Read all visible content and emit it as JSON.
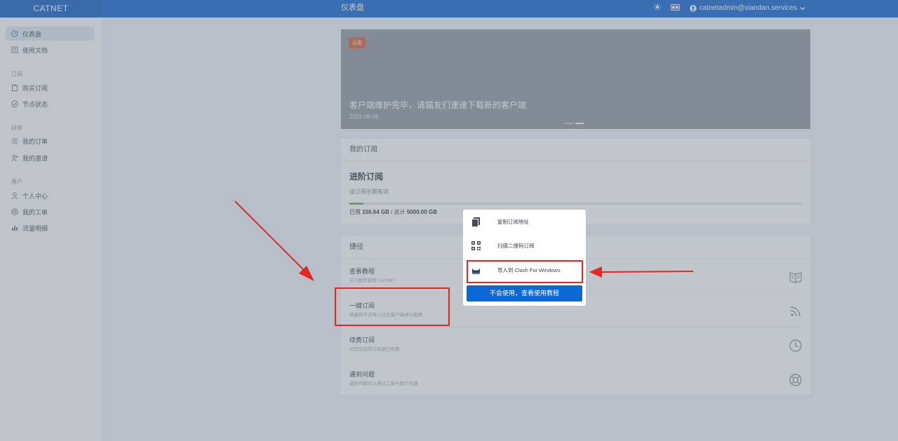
{
  "header": {
    "brand": "CATNET",
    "page_title": "仪表盘",
    "user_email": "catnetadmin@xiandan.services",
    "icons": [
      "theme-icon",
      "language-icon",
      "user-icon",
      "chevron-down-icon"
    ]
  },
  "sidebar": {
    "items": [
      {
        "label": "仪表盘",
        "icon": "dashboard-icon",
        "active": true
      },
      {
        "label": "使用文档",
        "icon": "document-icon"
      }
    ],
    "sections": [
      {
        "title": "订阅",
        "items": [
          {
            "label": "购买订阅",
            "icon": "clipboard-icon"
          },
          {
            "label": "节点状态",
            "icon": "check-circle-icon"
          }
        ]
      },
      {
        "title": "财务",
        "items": [
          {
            "label": "我的订单",
            "icon": "list-icon"
          },
          {
            "label": "我的邀请",
            "icon": "invite-icon"
          }
        ]
      },
      {
        "title": "用户",
        "items": [
          {
            "label": "个人中心",
            "icon": "person-icon"
          },
          {
            "label": "我的工单",
            "icon": "ticket-icon"
          },
          {
            "label": "流量明细",
            "icon": "bar-chart-icon"
          }
        ]
      }
    ]
  },
  "announcement": {
    "tag": "公告",
    "headline": "客户端维护完毕，请猫友们速速下载新的客户端",
    "date": "2022-09-08"
  },
  "subscription": {
    "card_title": "我的订阅",
    "plan_name": "进阶订阅",
    "validity": "该订阅长期有效",
    "used_label": "已用",
    "used": "156.64 GB",
    "total_label": "总计",
    "total": "5000.00 GB",
    "used_fraction": 0.031
  },
  "shortcuts": {
    "card_title": "捷径",
    "items": [
      {
        "title": "查看教程",
        "desc": "学习如何使用 CATNET",
        "icon": "book-icon"
      },
      {
        "title": "一键订阅",
        "desc": "快速将节点导入对应客户端进行使用",
        "icon": "rss-icon"
      },
      {
        "title": "续费订阅",
        "desc": "对您当前的订阅进行续费",
        "icon": "clock-icon"
      },
      {
        "title": "遇到问题",
        "desc": "遇到问题可以通过工单与我们沟通",
        "icon": "lifebuoy-icon"
      }
    ]
  },
  "popup": {
    "items": [
      {
        "label": "复制订阅地址",
        "icon": "copy-icon"
      },
      {
        "label": "扫描二维码订阅",
        "icon": "qrcode-icon"
      },
      {
        "label": "导入到 Clash For Windows",
        "icon": "clash-cat-icon"
      }
    ],
    "help_button": "不会使用，查看使用教程"
  },
  "annotations": {
    "color": "#e8261f"
  },
  "colors": {
    "topbar": "#0a5fd1",
    "primary_button": "#0b69d6",
    "progress": "#5cb85c",
    "tag": "#d95c35"
  }
}
